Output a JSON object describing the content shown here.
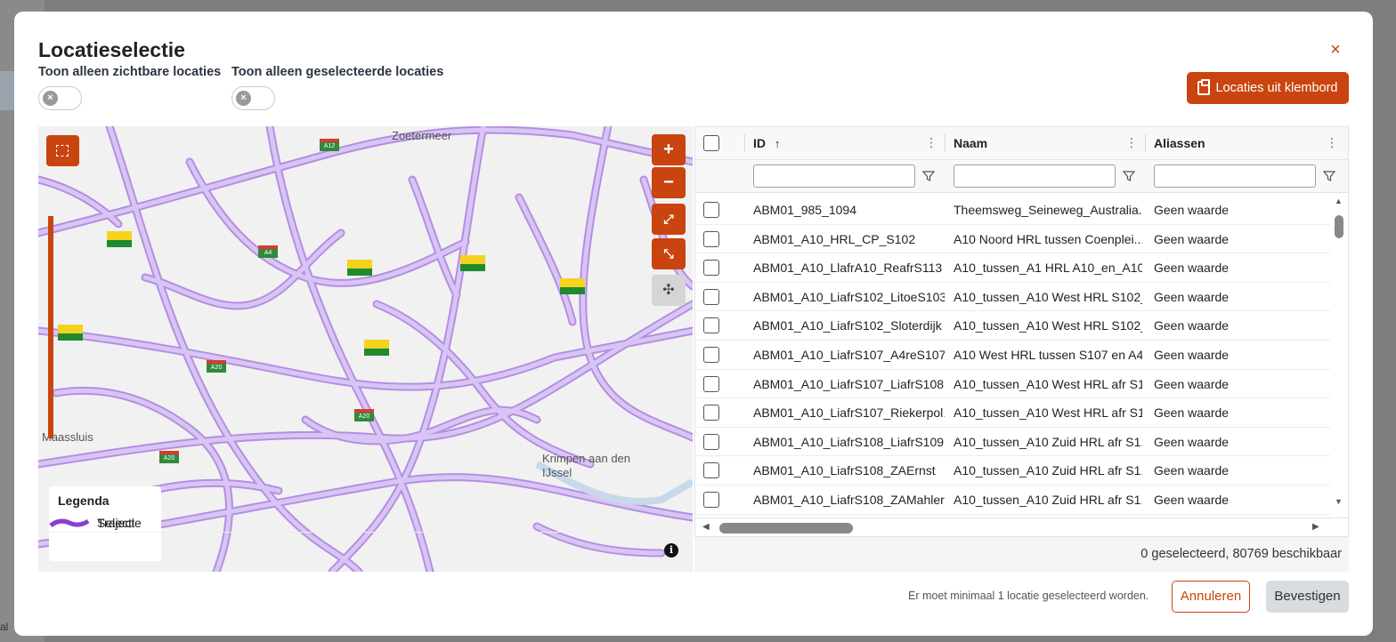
{
  "backdrop": {
    "text": "al"
  },
  "dialog": {
    "title": "Locatieselectie",
    "close_label": "×",
    "toggle_visible_label": "Toon alleen zichtbare locaties",
    "toggle_selected_label": "Toon alleen geselecteerde locaties",
    "toggle_knob_symbol": "×",
    "clipboard_button_label": "Locaties uit klembord"
  },
  "map": {
    "place_labels": [
      "Zoetermeer",
      "Maassluis",
      "Krimpen aan den IJssel"
    ],
    "road_sign_labels": [
      "A12",
      "A4",
      "A20",
      "A20",
      "A20"
    ],
    "zoom_in_label": "+",
    "zoom_out_label": "−",
    "legend": {
      "title": "Legenda",
      "items": [
        {
          "label": "Traject",
          "style": "outline",
          "color": "#b48fe0"
        },
        {
          "label": "Selectie",
          "style": "solid",
          "color": "#8a3fd1"
        }
      ]
    },
    "info_label": "i",
    "colors": {
      "road": "#d9c5f5",
      "road_edge": "#b48fe0",
      "accent": "#c9440e"
    }
  },
  "grid": {
    "columns": [
      {
        "key": "id",
        "label": "ID",
        "sort": "↑"
      },
      {
        "key": "naam",
        "label": "Naam"
      },
      {
        "key": "aliassen",
        "label": "Aliassen"
      }
    ],
    "rows": [
      {
        "id": "ABM01_985_1094",
        "naam": "Theemsweg_Seineweg_Australia...",
        "aliassen": "Geen waarde"
      },
      {
        "id": "ABM01_A10_HRL_CP_S102",
        "naam": "A10 Noord HRL tussen Coenplei...",
        "aliassen": "Geen waarde"
      },
      {
        "id": "ABM01_A10_LlafrA10_ReafrS113",
        "naam": "A10_tussen_A1 HRL A10_en_A10 ...",
        "aliassen": "Geen waarde"
      },
      {
        "id": "ABM01_A10_LiafrS102_LitoeS103",
        "naam": "A10_tussen_A10 West HRL S102_...",
        "aliassen": "Geen waarde"
      },
      {
        "id": "ABM01_A10_LiafrS102_Sloterdijk",
        "naam": "A10_tussen_A10 West HRL S102_...",
        "aliassen": "Geen waarde"
      },
      {
        "id": "ABM01_A10_LiafrS107_A4reS107",
        "naam": "A10 West HRL tussen S107 en A4...",
        "aliassen": "Geen waarde"
      },
      {
        "id": "ABM01_A10_LiafrS107_LiafrS108",
        "naam": "A10_tussen_A10 West HRL afr S1...",
        "aliassen": "Geen waarde"
      },
      {
        "id": "ABM01_A10_LiafrS107_Riekerpol...",
        "naam": "A10_tussen_A10 West HRL afr S1...",
        "aliassen": "Geen waarde"
      },
      {
        "id": "ABM01_A10_LiafrS108_LiafrS109",
        "naam": "A10_tussen_A10 Zuid HRL afr S1...",
        "aliassen": "Geen waarde"
      },
      {
        "id": "ABM01_A10_LiafrS108_ZAErnst",
        "naam": "A10_tussen_A10 Zuid HRL afr S1...",
        "aliassen": "Geen waarde"
      },
      {
        "id": "ABM01_A10_LiafrS108_ZAMahler",
        "naam": "A10_tussen_A10 Zuid HRL afr S1...",
        "aliassen": "Geen waarde"
      }
    ],
    "footer_status": "0 geselecteerd, 80769 beschikbaar"
  },
  "actions": {
    "warning": "Er moet minimaal 1 locatie geselecteerd worden.",
    "cancel_label": "Annuleren",
    "confirm_label": "Bevestigen"
  }
}
